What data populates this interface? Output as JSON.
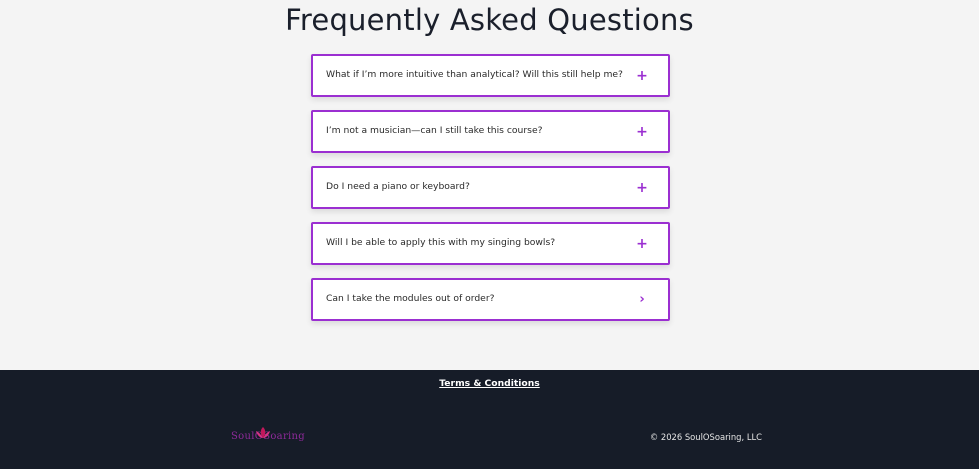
{
  "faq": {
    "title": "Frequently Asked Questions",
    "items": [
      {
        "question": "What if I’m more intuitive than analytical? Will this still help me?",
        "toggle": "+",
        "toggle_icon": "plus-icon"
      },
      {
        "question": "I’m not a musician—can I still take this course?",
        "toggle": "+",
        "toggle_icon": "plus-icon"
      },
      {
        "question": "Do I need a piano or keyboard?",
        "toggle": "+",
        "toggle_icon": "plus-icon"
      },
      {
        "question": "Will I be able to apply this with my singing bowls?",
        "toggle": "+",
        "toggle_icon": "plus-icon"
      },
      {
        "question": "Can I take the modules out of order?",
        "toggle": "›",
        "toggle_icon": "chevron-right-icon"
      }
    ]
  },
  "footer": {
    "terms_label": "Terms & Conditions",
    "logo_text": "SoulOSoaring",
    "copyright": "© 2026 SoulOSoaring, LLC"
  },
  "colors": {
    "accent": "#9b2fd1",
    "footer_bg": "#161c28",
    "page_bg": "#f4f4f4",
    "logo": "#8e2a9a"
  }
}
